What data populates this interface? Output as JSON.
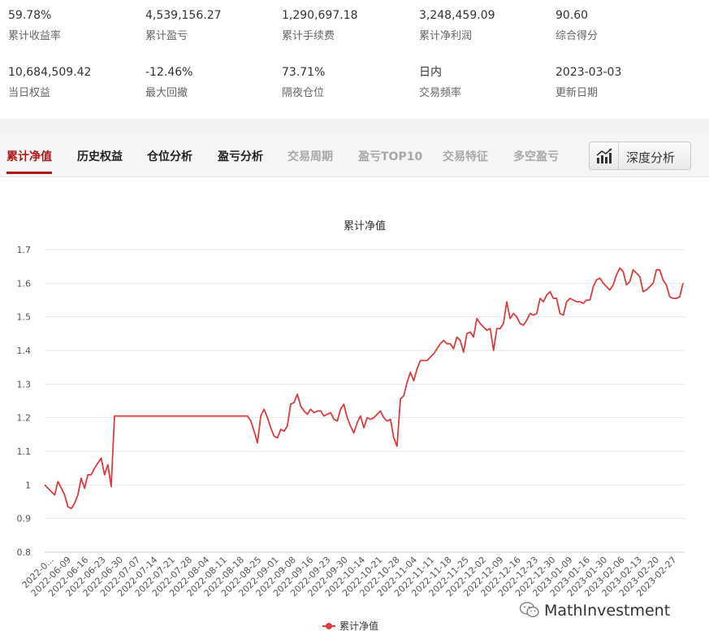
{
  "stats": [
    {
      "value": "59.78%",
      "label": "累计收益率"
    },
    {
      "value": "4,539,156.27",
      "label": "累计盈亏"
    },
    {
      "value": "1,290,697.18",
      "label": "累计手续费"
    },
    {
      "value": "3,248,459.09",
      "label": "累计净利润"
    },
    {
      "value": "90.60",
      "label": "综合得分"
    },
    {
      "value": "10,684,509.42",
      "label": "当日权益"
    },
    {
      "value": "-12.46%",
      "label": "最大回撤"
    },
    {
      "value": "73.71%",
      "label": "隔夜仓位"
    },
    {
      "value": "日内",
      "label": "交易频率"
    },
    {
      "value": "2023-03-03",
      "label": "更新日期"
    }
  ],
  "tabs": [
    {
      "label": "累计净值"
    },
    {
      "label": "历史权益"
    },
    {
      "label": "仓位分析"
    },
    {
      "label": "盈亏分析"
    },
    {
      "label": "交易周期"
    },
    {
      "label": "盈亏TOP10"
    },
    {
      "label": "交易特征"
    },
    {
      "label": "多空盈亏"
    }
  ],
  "deep_button": {
    "label": "深度分析",
    "icon": "bar-chart-icon"
  },
  "watermark": {
    "text": "MathInvestment",
    "icon": "wechat-icon"
  },
  "chart_data": {
    "type": "line",
    "title": "累计净值",
    "legend": "bottom",
    "grid": true,
    "ylim": [
      0.8,
      1.7
    ],
    "yticks": [
      "0.8",
      "0.9",
      "1",
      "1.1",
      "1.2",
      "1.3",
      "1.4",
      "1.5",
      "1.6",
      "1.7"
    ],
    "xtick_labels": [
      "2022-0...",
      "2022-06-09",
      "2022-06-16",
      "2022-06-23",
      "2022-06-30",
      "2022-07-07",
      "2022-07-14",
      "2022-07-21",
      "2022-07-28",
      "2022-08-04",
      "2022-08-11",
      "2022-08-18",
      "2022-08-25",
      "2022-09-01",
      "2022-09-08",
      "2022-09-16",
      "2022-09-23",
      "2022-09-30",
      "2022-10-14",
      "2022-10-21",
      "2022-10-28",
      "2022-11-04",
      "2022-11-11",
      "2022-11-18",
      "2022-11-25",
      "2022-12-02",
      "2022-12-09",
      "2022-12-16",
      "2022-12-23",
      "2022-12-30",
      "2023-01-09",
      "2023-01-16",
      "2023-01-30",
      "2023-02-06",
      "2023-02-13",
      "2023-02-20",
      "2023-02-27"
    ],
    "series": [
      {
        "name": "累计净值",
        "color": "#dd3c3c",
        "values": [
          1.0,
          0.99,
          0.98,
          0.97,
          1.01,
          0.99,
          0.97,
          0.935,
          0.93,
          0.945,
          0.97,
          1.02,
          0.99,
          1.03,
          1.03,
          1.05,
          1.065,
          1.08,
          1.03,
          1.06,
          0.995,
          1.205,
          1.205,
          1.205,
          1.205,
          1.205,
          1.205,
          1.205,
          1.205,
          1.205,
          1.205,
          1.205,
          1.205,
          1.205,
          1.205,
          1.205,
          1.205,
          1.205,
          1.205,
          1.205,
          1.205,
          1.205,
          1.205,
          1.205,
          1.205,
          1.205,
          1.205,
          1.205,
          1.205,
          1.205,
          1.205,
          1.205,
          1.205,
          1.205,
          1.205,
          1.205,
          1.205,
          1.205,
          1.205,
          1.205,
          1.205,
          1.205,
          1.19,
          1.16,
          1.125,
          1.205,
          1.225,
          1.2,
          1.17,
          1.145,
          1.14,
          1.165,
          1.16,
          1.175,
          1.24,
          1.245,
          1.27,
          1.235,
          1.22,
          1.21,
          1.225,
          1.215,
          1.22,
          1.22,
          1.205,
          1.21,
          1.215,
          1.195,
          1.19,
          1.225,
          1.24,
          1.2,
          1.175,
          1.155,
          1.185,
          1.205,
          1.17,
          1.2,
          1.195,
          1.2,
          1.21,
          1.22,
          1.2,
          1.19,
          1.195,
          1.14,
          1.115,
          1.255,
          1.265,
          1.305,
          1.335,
          1.31,
          1.345,
          1.37,
          1.37,
          1.37,
          1.38,
          1.39,
          1.405,
          1.42,
          1.43,
          1.42,
          1.42,
          1.405,
          1.44,
          1.43,
          1.395,
          1.45,
          1.455,
          1.44,
          1.495,
          1.48,
          1.47,
          1.46,
          1.465,
          1.4,
          1.465,
          1.465,
          1.48,
          1.545,
          1.495,
          1.51,
          1.5,
          1.48,
          1.475,
          1.49,
          1.51,
          1.505,
          1.51,
          1.555,
          1.545,
          1.565,
          1.575,
          1.555,
          1.555,
          1.51,
          1.505,
          1.545,
          1.555,
          1.55,
          1.545,
          1.545,
          1.54,
          1.55,
          1.55,
          1.59,
          1.61,
          1.615,
          1.6,
          1.59,
          1.58,
          1.595,
          1.625,
          1.645,
          1.635,
          1.595,
          1.605,
          1.64,
          1.63,
          1.62,
          1.575,
          1.58,
          1.59,
          1.6,
          1.64,
          1.64,
          1.61,
          1.595,
          1.56,
          1.555,
          1.555,
          1.56,
          1.6
        ]
      }
    ]
  }
}
